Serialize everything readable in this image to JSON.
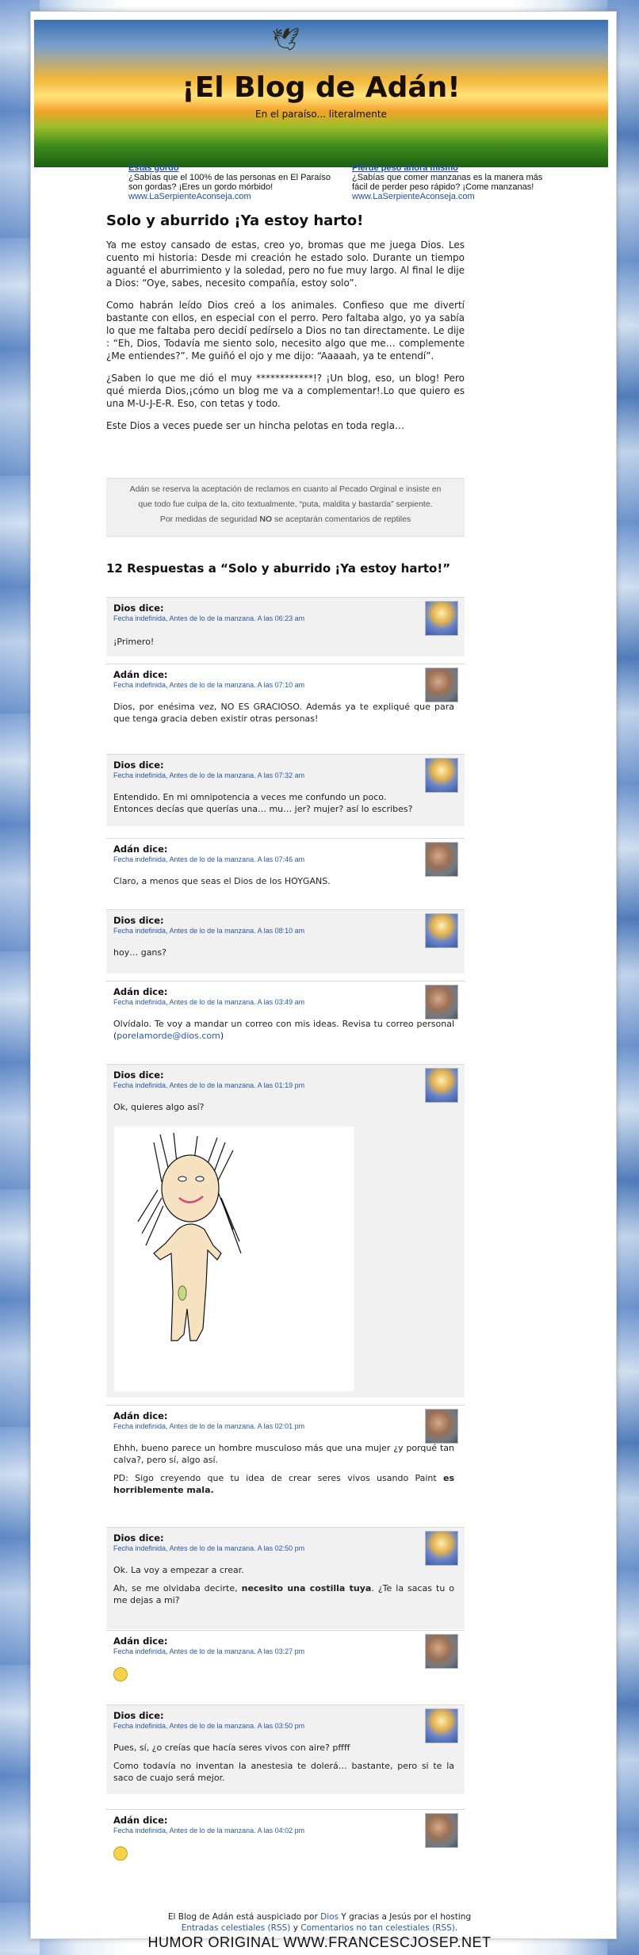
{
  "header": {
    "title": "¡El Blog de Adán!",
    "subtitle": "En el paraíso... literalmente"
  },
  "ads": [
    {
      "title": "Estas gordo",
      "text": "¿Sabías que el 100% de las personas en El Paraíso son gordas? ¡Eres un gordo mórbido!",
      "url": "www.LaSerpienteAconseja.com"
    },
    {
      "title": "Pierde peso ahora mismo",
      "text": "¿Sabías que comer manzanas es la manera más fácil de perder peso rápido? ¡Come manzanas!",
      "url": "www.LaSerpienteAconseja.com"
    }
  ],
  "post": {
    "title": "Solo y aburrido ¡Ya estoy harto!",
    "paragraphs": [
      "Ya me estoy cansado de estas, creo yo, bromas que me juega Dios. Les cuento mi historia: Desde mi creación he estado solo. Durante un tiempo aguanté el aburrimiento y la soledad, pero no fue muy largo. Al final le dije a Dios: “Oye, sabes, necesito compañía, estoy solo”.",
      "Como habrán leído Dios creó a los animales. Confieso que me divertí bastante con ellos, en especial con el perro. Pero faltaba algo, yo ya sabía lo que me faltaba pero decidí pedírselo a Dios no tan directamente. Le dije : “Eh, Dios, Todavía me siento solo, necesito algo que me… complemente ¿Me entiendes?”. Me guiñó el ojo y me dijo: “Aaaaah, ya te entendí”.",
      "¿Saben lo que me dió el muy ************!? ¡Un blog, eso, un blog! Pero qué mierda Dios,¡cómo un blog me va a complementar!.Lo que quiero es una M-U-J-E-R. Eso, con tetas y todo.",
      "Este Dios a veces puede ser un hincha pelotas en toda regla…"
    ]
  },
  "notice": {
    "line1": "Adán se reserva la aceptación de reclamos en cuanto al Pecado Orginal e insiste en",
    "line2": "que todo fue culpa de la, cito textualmente, “puta, maldita y bastarda” serpiente.",
    "line3_pre": "Por medidas de seguridad ",
    "line3_bold": "NO",
    "line3_post": " se aceptarán comentarios de reptiles"
  },
  "responses_title": "12 Respuestas a “Solo y aburrido ¡Ya estoy harto!”",
  "comments": [
    {
      "author": "Dios dice:",
      "meta": "Fecha indefinida, Antes de lo de la manzana. A las 06:23 am",
      "p1": "¡Primero!"
    },
    {
      "author": "Adán dice:",
      "meta": "Fecha indefinida, Antes de lo de la manzana. A las 07:10 am",
      "p1": "Dios, por enésima vez, NO ES GRACIOSO. Además ya te expliqué que para que tenga gracia deben existir otras personas!"
    },
    {
      "author": "Dios dice:",
      "meta": "Fecha indefinida, Antes de lo de la manzana. A las 07:32 am",
      "p1": "Entendido. En mi omnipotencia a veces me confundo un poco.",
      "p2": "Entonces decías que querías una… mu… jer? mujer? así lo escribes?"
    },
    {
      "author": "Adán dice:",
      "meta": "Fecha indefinida, Antes de lo de la manzana. A las 07:46 am",
      "p1": "Claro, a menos que seas el Dios de los HOYGANS."
    },
    {
      "author": "Dios dice:",
      "meta": "Fecha indefinida, Antes de lo de la manzana. A las 08:10 am",
      "p1": "hoy… gans?"
    },
    {
      "author": "Adán dice:",
      "meta": "Fecha indefinida, Antes de lo de la manzana. A las 03:49 am",
      "p1": "Olvídalo. Te voy a mandar un correo con mis ideas. Revisa tu correo personal (",
      "link": "porelamorde@dios.com",
      "p1_end": ")"
    },
    {
      "author": "Dios dice:",
      "meta": "Fecha indefinida, Antes de lo de la manzana. A las 01:19 pm",
      "p1": "Ok, quieres algo así?"
    },
    {
      "author": "Adán dice:",
      "meta": "Fecha indefinida, Antes de lo de la manzana. A las 02:01 pm",
      "p1": "Ehhh, bueno parece un hombre musculoso más que una mujer ¿y porqué tan calva?, pero sí, algo así.",
      "p2_pre": "PD: Sigo creyendo que tu idea de crear seres vivos usando Paint ",
      "p2_bold": "es horriblemente mala."
    },
    {
      "author": "Dios dice:",
      "meta": "Fecha indefinida, Antes de lo de la manzana. A las 02:50 pm",
      "p1": "Ok. La voy a empezar a crear.",
      "p2_pre": "Ah, se me olvidaba decirte, ",
      "p2_bold": "necesito una costilla tuya",
      "p2_post": ". ¿Te la sacas tu o me dejas a mi?"
    },
    {
      "author": "Adán dice:",
      "meta": "Fecha indefinida, Antes de lo de la manzana. A las 03:27 pm"
    },
    {
      "author": "Dios dice:",
      "meta": "Fecha indefinida, Antes de lo de la manzana. A las 03:50 pm",
      "p1": "Pues, sí, ¿o creías que hacía seres vivos con aire? pffff",
      "p2": "Como todavía no inventan la anestesia te dolerá… bastante, pero si te la saco de cuajo será mejor."
    },
    {
      "author": "Adán dice:",
      "meta": "Fecha indefinida, Antes de lo de la manzana. A las 04:02 pm"
    }
  ],
  "footer": {
    "pre": "El Blog de Adán está auspiciado por ",
    "dios": "Dios",
    "mid": " Y gracias a Jesús por el hosting",
    "rss1": "Entradas celestiales (RSS)",
    "and": " y ",
    "rss2": "Comentarios no tan celestiales (RSS)",
    "end": "."
  },
  "watermark": "HUMOR ORIGINAL WWW.FRANCESCJOSEP.NET",
  "icons": [
    "bird-icon",
    "dios-avatar",
    "adan-avatar",
    "smiley-icon"
  ]
}
